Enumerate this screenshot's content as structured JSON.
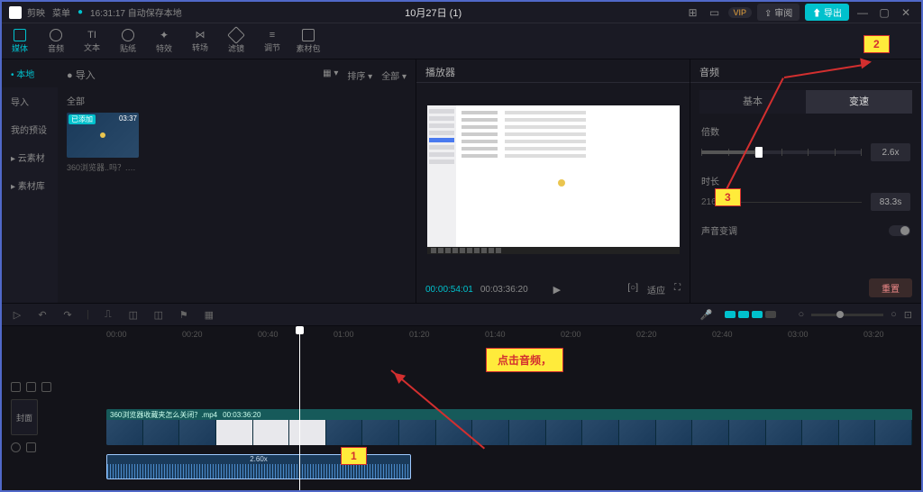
{
  "titlebar": {
    "app_name": "剪映",
    "menu": "菜单",
    "autosave": "16:31:17 自动保存本地",
    "project": "10月27日 (1)",
    "vip": "VIP",
    "review": "⇪ 审阅",
    "export": "⬆ 导出"
  },
  "tools": [
    {
      "label": "媒体"
    },
    {
      "label": "音频"
    },
    {
      "label": "文本"
    },
    {
      "label": "贴纸"
    },
    {
      "label": "特效"
    },
    {
      "label": "转场"
    },
    {
      "label": "滤镜"
    },
    {
      "label": "调节"
    },
    {
      "label": "素材包"
    }
  ],
  "sidebar": [
    {
      "label": "• 本地",
      "active": true
    },
    {
      "label": "导入"
    },
    {
      "label": "我的预设"
    },
    {
      "label": "▸ 云素材"
    },
    {
      "label": "▸ 素材库"
    }
  ],
  "media": {
    "import": "● 导入",
    "all": "全部",
    "sort": "排序 ▾",
    "filter": "全部 ▾",
    "thumb": {
      "badge": "已添加",
      "duration": "03:37",
      "name": "360浏览器..吗？.mp4"
    }
  },
  "player": {
    "title": "播放器",
    "cur": "00:00:54:01",
    "total": "00:03:36:20",
    "ratio": "适应"
  },
  "audio_panel": {
    "title": "音频",
    "tab_basic": "基本",
    "tab_speed": "变速",
    "speed_label": "倍数",
    "speed_val": "2.6x",
    "dur_label": "时长",
    "dur_orig": "216.7s",
    "dur_new": "83.3s",
    "pitch": "声音变调",
    "reset": "重置"
  },
  "ruler": [
    "00:00",
    "00:20",
    "00:40",
    "01:00",
    "01:20",
    "01:40",
    "02:00",
    "02:20",
    "02:40",
    "03:00",
    "03:20"
  ],
  "clip": {
    "name": "360浏览器收藏夹怎么关闭？.mp4",
    "dur": "00:03:36:20",
    "speed": "2.60x"
  },
  "cover": "封面",
  "anno": {
    "tag1": "1",
    "tag2": "2",
    "tag3": "3",
    "callout": "点击音频，"
  }
}
